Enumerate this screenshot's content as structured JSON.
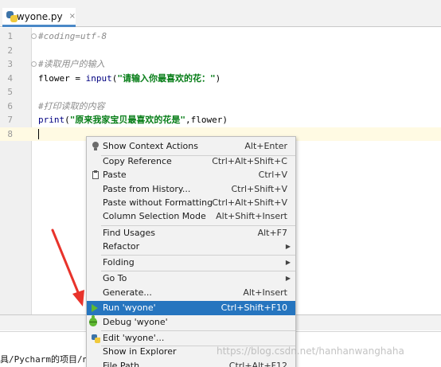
{
  "tab": {
    "filename": "wyone.py",
    "close": "×"
  },
  "editor": {
    "lines": [
      {
        "num": "1",
        "code": "#coding=utf-8"
      },
      {
        "num": "2",
        "code": ""
      },
      {
        "num": "3",
        "code": "#读取用户的输入"
      },
      {
        "num": "4",
        "code_prefix": "flower = ",
        "code_func": "input",
        "code_open": "(",
        "code_str": "\"请输入你最喜欢的花：\"",
        "code_close": ")"
      },
      {
        "num": "5",
        "code": ""
      },
      {
        "num": "6",
        "code": "#打印读取的内容"
      },
      {
        "num": "7",
        "code_func": "print",
        "code_open": "(",
        "code_str": "\"原来我家宝贝最喜欢的花是\"",
        "code_rest": ",flower)"
      },
      {
        "num": "8",
        "code": ""
      }
    ]
  },
  "menu": {
    "items": [
      {
        "label": "Show Context Actions",
        "shortcut": "Alt+Enter",
        "icon": "bulb-icon"
      },
      {
        "label": "Copy Reference",
        "shortcut": "Ctrl+Alt+Shift+C"
      },
      {
        "label": "Paste",
        "shortcut": "Ctrl+V",
        "icon": "clipboard-icon"
      },
      {
        "label": "Paste from History...",
        "shortcut": "Ctrl+Shift+V"
      },
      {
        "label": "Paste without Formatting",
        "shortcut": "Ctrl+Alt+Shift+V"
      },
      {
        "label": "Column Selection Mode",
        "shortcut": "Alt+Shift+Insert"
      },
      {
        "label": "Find Usages",
        "shortcut": "Alt+F7"
      },
      {
        "label": "Refactor",
        "submenu": "▶"
      },
      {
        "label": "Folding",
        "submenu": "▶"
      },
      {
        "label": "Go To",
        "submenu": "▶"
      },
      {
        "label": "Generate...",
        "shortcut": "Alt+Insert"
      },
      {
        "label": "Run 'wyone'",
        "shortcut": "Ctrl+Shift+F10",
        "icon": "run-icon",
        "selected": true
      },
      {
        "label": "Debug 'wyone'",
        "icon": "debug-icon"
      },
      {
        "label": "Edit 'wyone'...",
        "icon": "python-icon"
      },
      {
        "label": "Show in Explorer"
      },
      {
        "label": "File Path",
        "shortcut": "Ctrl+Alt+F12"
      }
    ]
  },
  "terminal": {
    "text": "具/Pycharm的项目/n"
  },
  "watermark": "https://blog.csdn.net/hanhanwanghaha",
  "colors": {
    "selection": "#2675bf",
    "arrow": "#e8332b",
    "run": "#5fb832"
  }
}
